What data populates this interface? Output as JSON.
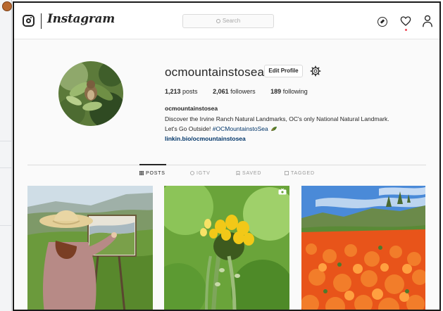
{
  "brand": {
    "wordmark": "Instagram"
  },
  "search": {
    "placeholder": "Search"
  },
  "profile": {
    "username": "ocmountainstosea",
    "edit_label": "Edit Profile",
    "stats": {
      "posts": "1,213",
      "posts_label": "posts",
      "followers": "2,061",
      "followers_label": "followers",
      "following": "189",
      "following_label": "following"
    },
    "full_name": "ocmountainstosea",
    "bio_line1": "Discover the Irvine Ranch Natural Landmarks, OC's only National Natural Landmark.",
    "bio_line2_text": "Let's Go Outside! ",
    "bio_line2_hashtag": "#OCMountainstoSea",
    "link": "linkin.bio/ocmountainstosea"
  },
  "tabs": [
    {
      "label": "POSTS",
      "active": true
    },
    {
      "label": "IGTV",
      "active": false
    },
    {
      "label": "SAVED",
      "active": false
    },
    {
      "label": "TAGGED",
      "active": false
    }
  ],
  "icons": [
    "instagram-glyph-icon",
    "search-icon",
    "explore-compass-icon",
    "activity-heart-icon",
    "profile-person-icon",
    "settings-gear-icon",
    "grid-icon",
    "igtv-icon",
    "bookmark-icon",
    "tag-icon",
    "leaf-emoji-icon",
    "igtv-badge-icon"
  ],
  "colors": {
    "link": "#003569",
    "text": "#262626",
    "muted": "#999999",
    "notification": "#ed4956"
  }
}
